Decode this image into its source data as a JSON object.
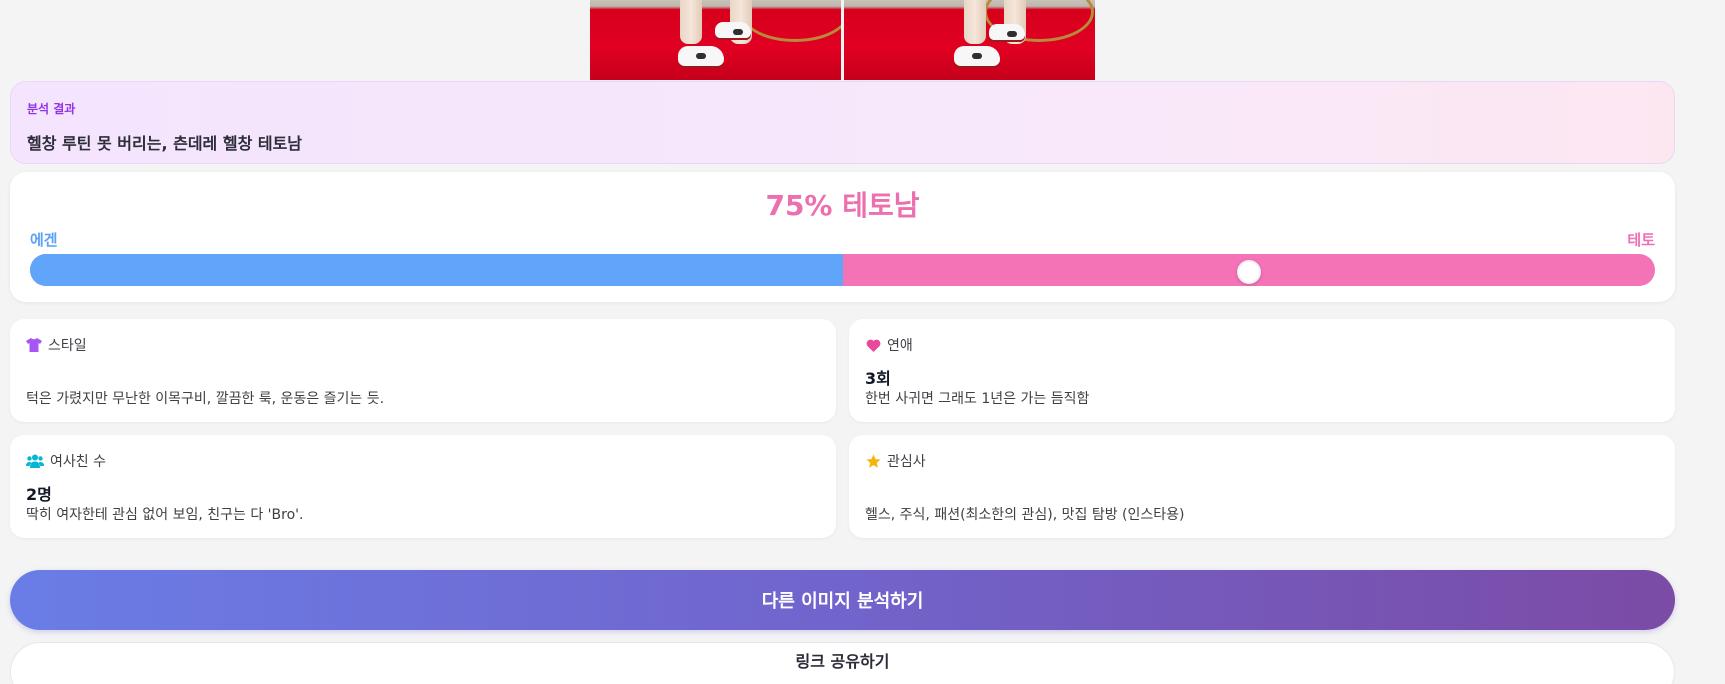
{
  "result": {
    "label": "분석 결과",
    "title": "헬창 루틴 못 버리는, 츤데레 헬창 테토남"
  },
  "meter": {
    "headline": "75% 테토남",
    "left_label": "에겐",
    "right_label": "테토",
    "teto_fraction": 0.75,
    "colors": {
      "egen": "#60a5fa",
      "teto": "#f472b6"
    }
  },
  "cards": {
    "style": {
      "icon": "shirt-icon",
      "label": "스타일",
      "value": "",
      "desc": "턱은 가렸지만 무난한 이목구비, 깔끔한 룩, 운동은 즐기는 듯."
    },
    "love": {
      "icon": "heart-icon",
      "label": "연애",
      "value": "3회",
      "desc": "한번 사귀면 그래도 1년은 가는 듬직함"
    },
    "friends": {
      "icon": "users-icon",
      "label": "여사친 수",
      "value": "2명",
      "desc": "딱히 여자한테 관심 없어 보임, 친구는 다 'Bro'."
    },
    "interests": {
      "icon": "star-icon",
      "label": "관심사",
      "value": "",
      "desc": "헬스, 주식, 패션(최소한의 관심), 맛집 탐방 (인스타용)"
    }
  },
  "buttons": {
    "analyze_again": "다른 이미지 분석하기",
    "share_link": "링크 공유하기"
  }
}
